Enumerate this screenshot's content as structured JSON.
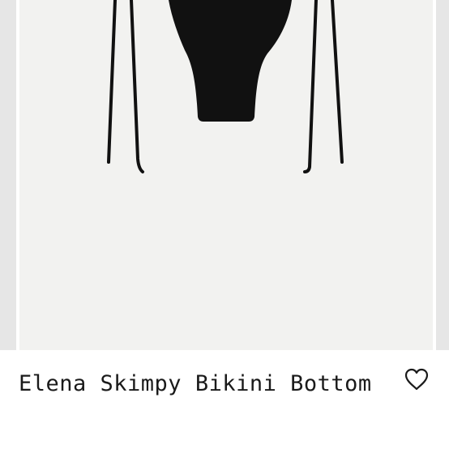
{
  "product": {
    "title": "Elena Skimpy Bikini Bottom",
    "image_alt": "black bikini bottom"
  },
  "icons": {
    "wishlist": "heart-outline-icon"
  },
  "colors": {
    "garment": "#111111",
    "image_background": "#f2f2f0",
    "text": "#1a1a1a"
  }
}
